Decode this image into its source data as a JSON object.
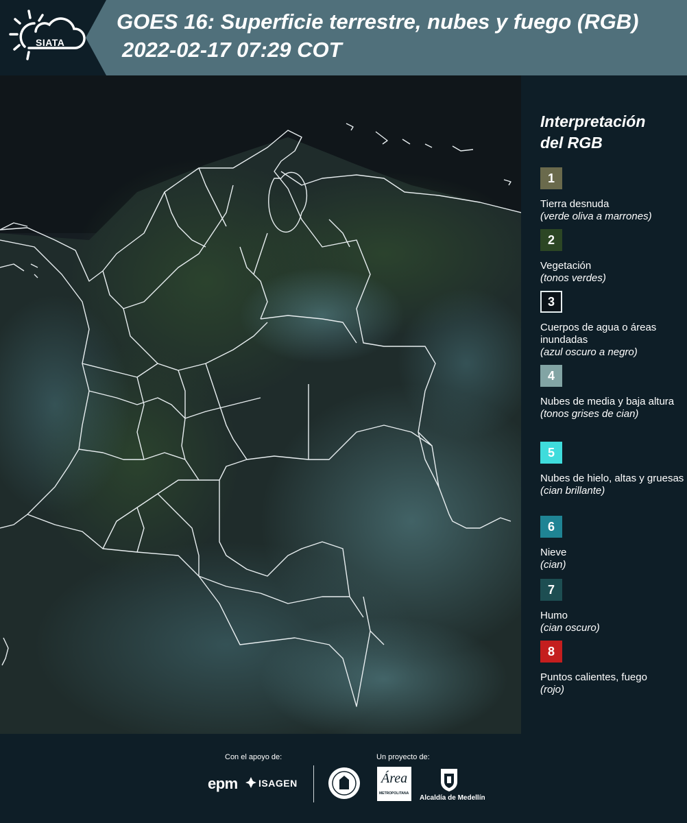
{
  "header": {
    "logo_text": "SIATA",
    "title_line1": "GOES 16: Superficie terrestre, nubes y fuego (RGB)",
    "title_line2": "2022-02-17 07:29 COT"
  },
  "map": {
    "description_icon": "satellite-rgb-composite"
  },
  "legend": {
    "title_line1": "Interpretación",
    "title_line2": "del RGB",
    "items": [
      {
        "number": "1",
        "color": "#6a6a4c",
        "label": "Tierra desnuda",
        "sub": "(verde oliva a marrones)"
      },
      {
        "number": "2",
        "color": "#2c4624",
        "label": "Vegetación",
        "sub": "(tonos verdes)"
      },
      {
        "number": "3",
        "color": "#0b1218",
        "label": "Cuerpos de agua o áreas inundadas",
        "sub": "(azul oscuro a negro)"
      },
      {
        "number": "4",
        "color": "#82a4a4",
        "label": "Nubes de media y baja altura",
        "sub": "(tonos grises de cian)"
      },
      {
        "number": "5",
        "color": "#3fdcdc",
        "label": "Nubes de hielo, altas y gruesas",
        "sub": "(cian brillante)"
      },
      {
        "number": "6",
        "color": "#1f8494",
        "label": "Nieve",
        "sub": "(cian)"
      },
      {
        "number": "7",
        "color": "#1d4e52",
        "label": "Humo",
        "sub": "(cian oscuro)"
      },
      {
        "number": "8",
        "color": "#c41e1e",
        "label": "Puntos calientes, fuego",
        "sub": "(rojo)"
      }
    ]
  },
  "footer": {
    "support_caption": "Con el apoyo de:",
    "project_caption": "Un proyecto de:",
    "sponsor_epm": "epm",
    "sponsor_isagen": "ISAGEN",
    "area_metro_text": "Área",
    "area_metro_sub": "METROPOLITANA",
    "alcaldia_text": "Alcaldía de Medellín"
  }
}
